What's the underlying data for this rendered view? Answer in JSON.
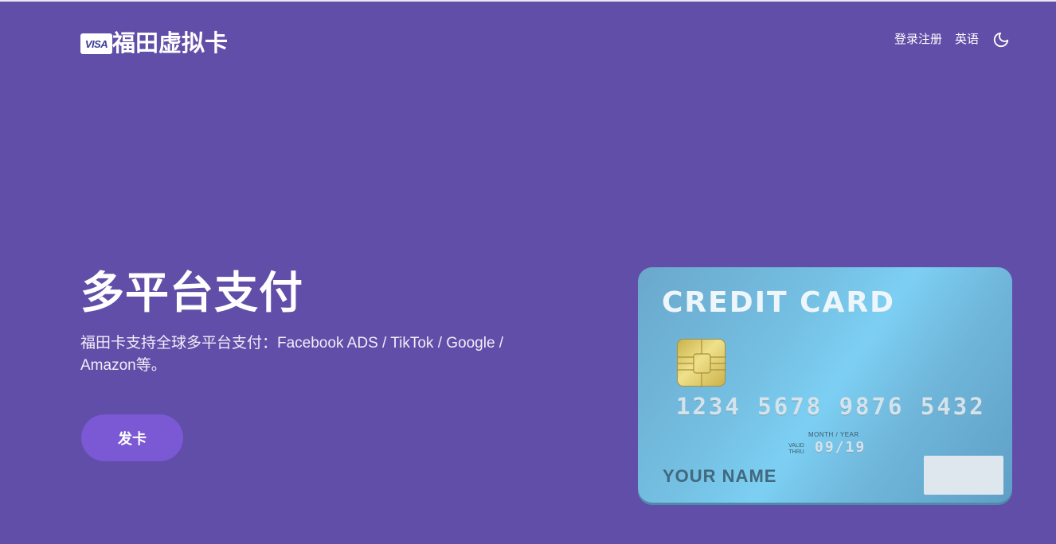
{
  "header": {
    "logo_badge": "VISA",
    "brand_name": "福田虚拟卡",
    "nav": {
      "login_register": "登录注册",
      "language": "英语"
    },
    "theme_icon": "moon-icon"
  },
  "hero": {
    "title": "多平台支付",
    "description": "福田卡支持全球多平台支付：Facebook ADS / TikTok / Google / Amazon等。",
    "cta_label": "发卡"
  },
  "card": {
    "title": "CREDIT CARD",
    "number": "1234 5678 9876 5432",
    "month_year_label": "MONTH / YEAR",
    "valid_thru_label": "VALID THRU",
    "expiry": "09/19",
    "holder_name": "YOUR NAME"
  },
  "colors": {
    "background": "#614ea8",
    "button": "#7b58d4",
    "card_gradient": "#74bfe2"
  }
}
